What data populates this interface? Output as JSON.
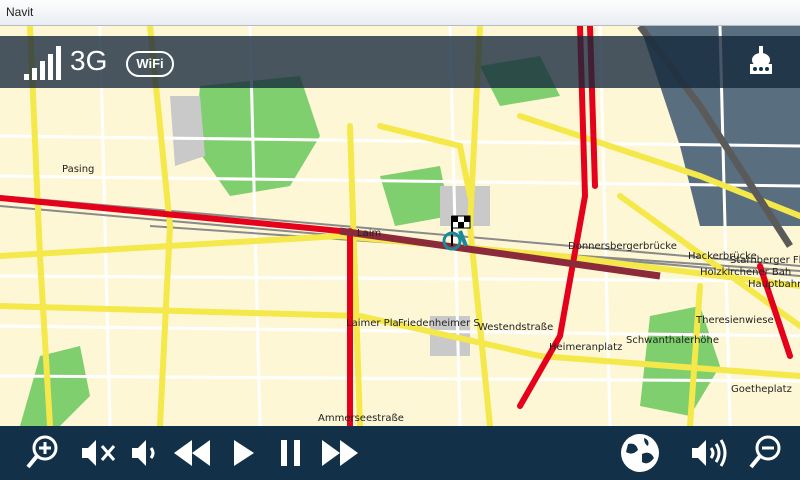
{
  "window": {
    "title": "Navit"
  },
  "status": {
    "network": "3G",
    "wifi_label": "WiFi"
  },
  "map_labels": {
    "pasing": "Pasing",
    "laim": "Laim",
    "donnersbergerbruecke": "Donnersbergerbrücke",
    "hackerbruecke": "Hackerbrücke",
    "starnberger": "Starnberger Flüg",
    "holzkirchener": "Holzkirchener Bah",
    "hauptbahnhof": "Hauptbahnhof",
    "laimer_platz": "Laimer Pla",
    "friedenheimer": "Friedenheimer S",
    "westendstrasse": "Westendstraße",
    "heimeranplatz": "Heimeranplatz",
    "schwanthalerhoehe": "Schwanthalerhöhe",
    "theresienwiese": "Theresienwiese",
    "goetheplatz": "Goetheplatz",
    "partial_bottom": "Ammerseestraße"
  },
  "icons": {
    "zoom_in": "zoom-in-icon",
    "mute": "mute-icon",
    "volume_down": "volume-down-icon",
    "rewind": "rewind-icon",
    "play": "play-icon",
    "pause": "pause-icon",
    "fast_forward": "fast-forward-icon",
    "globe": "globe-icon",
    "volume_up": "volume-up-icon",
    "zoom_out": "zoom-out-icon",
    "gps": "gps-satellite-icon",
    "signal": "signal-strength-icon"
  },
  "colors": {
    "road_main": "#e5001b",
    "road_secondary": "#f4e84a",
    "park": "#7fcf6e",
    "bar": "#123047"
  }
}
